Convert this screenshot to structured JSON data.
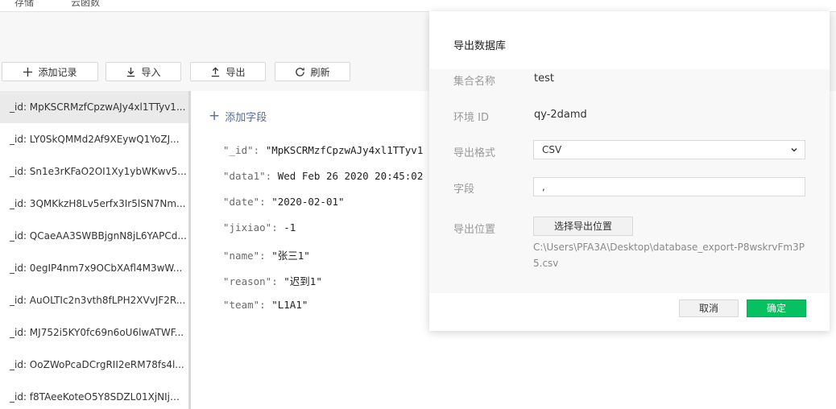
{
  "topbar": {
    "tabs": [
      "存储",
      "云函数"
    ]
  },
  "toolbar": {
    "add_record": "添加记录",
    "import": "导入",
    "export": "导出",
    "refresh": "刷新"
  },
  "records": [
    "_id: MpKSCRMzfCpzwAJy4xl1TTyv1...",
    "_id: LY0SkQMMd2Af9XEywQ1YoZJ...",
    "_id: Sn1e3rKFaO2OI1Xy1ybWKwv5...",
    "_id: 3QMKkzH8Lv5erfx3Ir5lSN7Nm...",
    "_id: QCaeAA3SWBBjgnN8jL6YAPCd...",
    "_id: 0egIP4nm7x9OCbXAfl4M3wW...",
    "_id: AuOLTIc2n3vth8fLPH2XVvJF2R...",
    "_id: MJ752i5KY0fc69n6oU6lwATWF...",
    "_id: OoZWoPcaDCrgRII2eRM78fs4l...",
    "_id: f8TAeeKoteO5Y8SDZL01XjNIjm..."
  ],
  "detail": {
    "add_field": "添加字段",
    "fields": [
      {
        "key": "\"_id\": ",
        "value": "\"MpKSCRMzfCpzwAJy4xl1TTyv1"
      },
      {
        "key": "\"data1\": ",
        "value": "Wed Feb 26 2020 20:45:02"
      },
      {
        "key": "\"date\": ",
        "value": "\"2020-02-01\""
      },
      {
        "key": "\"jixiao\": ",
        "value": "-1"
      },
      {
        "key": "\"name\": ",
        "value": "\"张三1\""
      },
      {
        "key": "\"reason\": ",
        "value": "\"迟到1\""
      },
      {
        "key": "\"team\": ",
        "value": "\"L1A1\""
      }
    ]
  },
  "modal": {
    "title": "导出数据库",
    "collection_label": "集合名称",
    "collection_value": "test",
    "env_label": "环境 ID",
    "env_value": "qy-2damd",
    "format_label": "导出格式",
    "format_value": "CSV",
    "fields_label": "字段",
    "fields_value": ",",
    "location_label": "导出位置",
    "choose_button": "选择导出位置",
    "path": "C:\\Users\\PFA3A\\Desktop\\database_export-P8wskrvFm3P5.csv",
    "cancel": "取消",
    "confirm": "确定"
  },
  "colors": {
    "accent_green": "#07c160",
    "link_blue": "#576b95"
  }
}
